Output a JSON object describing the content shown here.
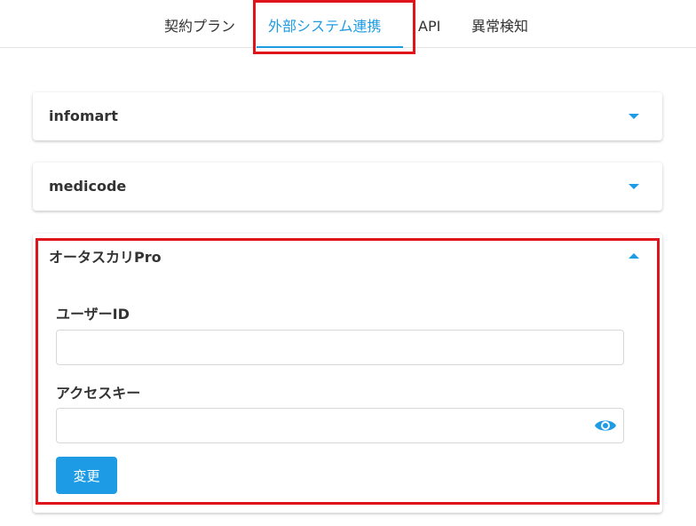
{
  "tabs": [
    {
      "label": "契約プラン"
    },
    {
      "label": "外部システム連携"
    },
    {
      "label": "API"
    },
    {
      "label": "異常検知"
    }
  ],
  "active_tab": "外部システム連携",
  "accent_color": "#1e9be5",
  "highlight_color": "#e0141b",
  "panels": [
    {
      "title": "infomart",
      "expanded": false
    },
    {
      "title": "medicode",
      "expanded": false
    },
    {
      "title": "オータスカリPro",
      "expanded": true,
      "user_id_label": "ユーザーID",
      "user_id_value": "",
      "access_key_label": "アクセスキー",
      "access_key_value": "",
      "submit_label": "変更",
      "reveal_icon": "eye-icon"
    }
  ]
}
